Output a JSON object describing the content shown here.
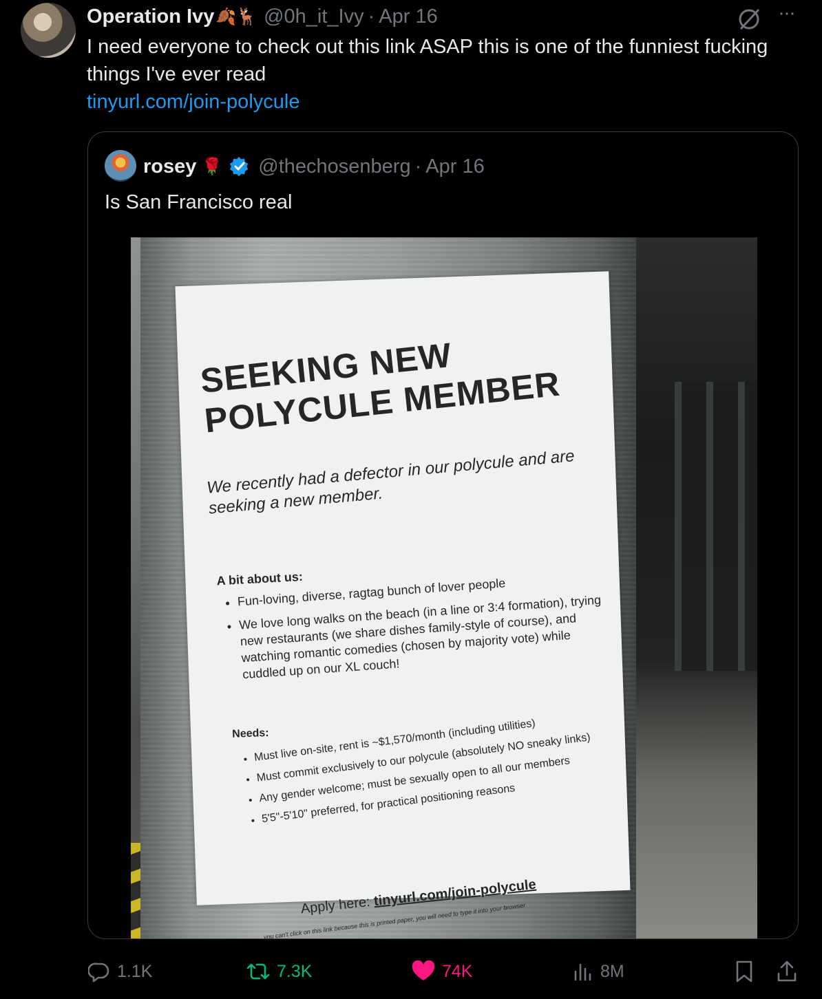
{
  "tweet": {
    "author_name": "Operation Ivy",
    "author_emoji": "🍂🦌",
    "handle": "@0h_it_Ivy",
    "separator": "·",
    "date": "Apr 16",
    "more_label": "···",
    "text": "I need everyone to check out this link ASAP this is one of the funniest fucking things I've ever read",
    "link": "tinyurl.com/join-polycule"
  },
  "quote": {
    "author_name": "rosey",
    "author_emoji": "🌹",
    "handle": "@thechosenberg",
    "separator": "·",
    "date": "Apr 16",
    "text": "Is San Francisco real",
    "flyer": {
      "title_line1": "SEEKING NEW",
      "title_line2": "POLYCULE MEMBER",
      "intro": "We recently had a defector in our polycule and are seeking a new member.",
      "about_heading": "A bit about us:",
      "about_items": [
        "Fun-loving, diverse, ragtag bunch of lover people",
        "We love long walks on the beach (in a line or 3:4 formation), trying new restaurants (we share dishes family-style of course), and watching romantic comedies (chosen by majority vote) while cuddled up on our XL couch!"
      ],
      "needs_heading": "Needs:",
      "needs_items": [
        "Must live on-site, rent is ~$1,570/month (including utilities)",
        "Must commit exclusively to our polycule (absolutely NO sneaky links)",
        "Any gender welcome; must be sexually open to all our members",
        "5'5\"-5'10\" preferred, for practical positioning reasons"
      ],
      "apply_label": "Apply here:",
      "apply_link": "tinyurl.com/join-polycule",
      "note": "you can't click on this link because this is printed paper, you will need to type it into your browser"
    }
  },
  "actions": {
    "replies": "1.1K",
    "retweets": "7.3K",
    "likes": "74K",
    "views": "8M"
  },
  "colors": {
    "link": "#1d9bf0",
    "muted": "#71767b",
    "retweet": "#00ba7c",
    "like": "#f91880",
    "verified": "#1d9bf0"
  },
  "icons": [
    "grok-icon",
    "more-icon",
    "verified-icon",
    "reply-icon",
    "retweet-icon",
    "like-icon",
    "views-icon",
    "bookmark-icon",
    "share-icon"
  ]
}
